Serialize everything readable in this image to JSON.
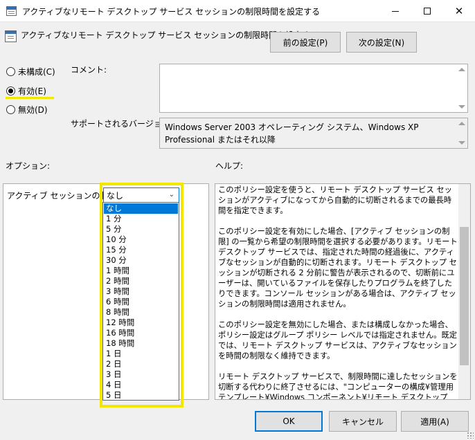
{
  "window": {
    "title": "アクティブなリモート デスクトップ サービス セッションの制限時間を設定する",
    "close_glyph": "✕"
  },
  "header": {
    "policy_title": "アクティブなリモート デスクトップ サービス セッションの制限時間を設定する",
    "prev_label": "前の設定(P)",
    "next_label": "次の設定(N)"
  },
  "state": {
    "unconfigured_label": "未構成(C)",
    "enabled_label": "有効(E)",
    "disabled_label": "無効(D)",
    "selected": "enabled",
    "highlight_color": "#f3e600"
  },
  "comment": {
    "label": "コメント:",
    "value": ""
  },
  "supported": {
    "label": "サポートされるバージョン:",
    "value": "Windows Server 2003 オペレーティング システム、Windows XP Professional またはそれ以降"
  },
  "options": {
    "label": "オプション:",
    "limit_label": "アクティブ セッションの制限:",
    "selected_value": "なし",
    "dropdown_items": [
      "なし",
      "1 分",
      "5 分",
      "10 分",
      "15 分",
      "30 分",
      "1 時間",
      "2 時間",
      "3 時間",
      "6 時間",
      "8 時間",
      "12 時間",
      "16 時間",
      "18 時間",
      "1 日",
      "2 日",
      "3 日",
      "4 日",
      "5 日"
    ]
  },
  "help": {
    "label": "ヘルプ:",
    "paragraphs": [
      "このポリシー設定を使うと、リモート デスクトップ サービス セッションがアクティブになってから自動的に切断されるまでの最長時間を指定できます。",
      "このポリシー設定を有効にした場合、[アクティブ セッションの制限] の一覧から希望の制限時間を選択する必要があります。リモート デスクトップ サービスでは、指定された時間の経過後に、アクティブなセッションが自動的に切断されます。リモート デスクトップ セッションが切断される 2 分前に警告が表示されるので、切断前にユーザーは、開いているファイルを保存したりプログラムを終了したりできます。コンソール セッションがある場合は、アクティブ セッションの制限時間は適用されません。",
      "このポリシー設定を無効にした場合、または構成しなかった場合、ポリシー設定はグループ ポリシー レベルでは指定されません。既定では、リモート デスクトップ サービスは、アクティブなセッションを時間の制限なく維持できます。",
      "リモート デスクトップ サービスで、制限時間に達したセッションを切断する代わりに終了させるには、\"コンピューターの構成¥管理用テンプレート¥Windows コンポーネント¥リモート デスクトップ サービス¥リモート デスクトップ セッション ホスト¥セッションの制限時間¥制限時間に達したらセッションを終了する\" ポリシー設定を構成します。"
    ]
  },
  "footer": {
    "ok_label": "OK",
    "cancel_label": "キャンセル",
    "apply_label": "適用(A)"
  }
}
